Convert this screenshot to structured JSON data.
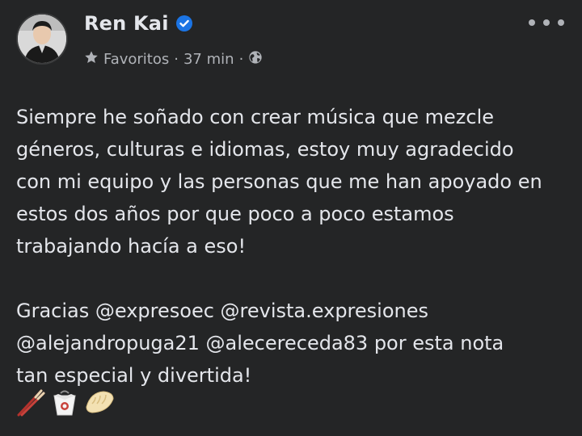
{
  "post": {
    "author": "Ren Kai",
    "audience": "Favoritos",
    "separator": "·",
    "time": "37 min",
    "paragraphs": [
      [
        "Siempre he soñado con crear música que mezcle",
        "géneros, culturas e idiomas, estoy muy agradecido",
        "con mi equipo y las personas que me han apoyado en",
        "estos dos años por que poco a poco estamos",
        "trabajando hacía a eso!"
      ],
      [
        "Gracias @expresoec @revista.expresiones",
        "@alejandropuga21 @alecereceda83 por esta nota",
        "tan especial y divertida!"
      ]
    ],
    "emojis": [
      "chopsticks-icon",
      "takeout-box-icon",
      "dumpling-icon"
    ]
  },
  "colors": {
    "background": "#242526",
    "text_primary": "#e4e6eb",
    "text_secondary": "#b0b3b8",
    "verified": "#1b74e4"
  },
  "icons": {
    "star": "star-icon",
    "globe": "globe-icon",
    "verified": "verified-badge-icon",
    "more": "more-options-icon"
  }
}
